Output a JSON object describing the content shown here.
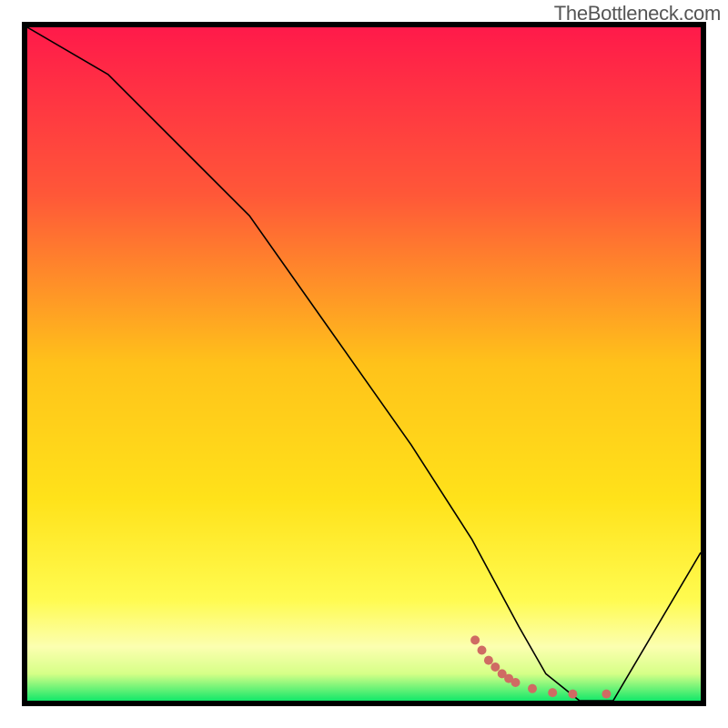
{
  "watermark": "TheBottleneck.com",
  "chart_data": {
    "type": "line",
    "title": "",
    "xlabel": "",
    "ylabel": "",
    "xlim": [
      0,
      100
    ],
    "ylim": [
      0,
      100
    ],
    "grid": false,
    "background": {
      "type": "vertical-gradient",
      "stops": [
        {
          "pos": 0.0,
          "color": "#ff1a4a"
        },
        {
          "pos": 0.25,
          "color": "#ff5838"
        },
        {
          "pos": 0.5,
          "color": "#ffc21a"
        },
        {
          "pos": 0.7,
          "color": "#ffe21a"
        },
        {
          "pos": 0.85,
          "color": "#fffb50"
        },
        {
          "pos": 0.92,
          "color": "#fcffb0"
        },
        {
          "pos": 0.96,
          "color": "#d6ff87"
        },
        {
          "pos": 1.0,
          "color": "#13e86a"
        }
      ]
    },
    "series": [
      {
        "name": "bottleneck-curve",
        "color": "#000000",
        "stroke_width": 1.6,
        "x": [
          0,
          12,
          25,
          33,
          45,
          57,
          66,
          73,
          77,
          82,
          87,
          100
        ],
        "y": [
          100,
          93,
          80,
          72,
          55,
          38,
          24,
          11,
          4,
          0,
          0,
          22
        ]
      }
    ],
    "markers": [
      {
        "name": "optimal-range-dots",
        "color": "#cf6b63",
        "size": 10,
        "x": [
          66.5,
          67.5,
          68.5,
          69.5,
          70.5,
          71.5,
          72.5,
          75,
          78,
          81,
          86
        ],
        "y": [
          9.0,
          7.5,
          6.0,
          5.0,
          4.0,
          3.3,
          2.7,
          1.8,
          1.2,
          1.0,
          1.0
        ]
      }
    ]
  }
}
